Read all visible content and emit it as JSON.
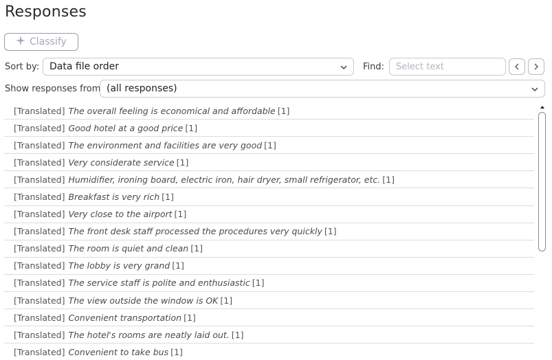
{
  "header": {
    "title": "Responses"
  },
  "toolbar": {
    "classify_label": "Classify"
  },
  "sort": {
    "label": "Sort by:",
    "value": "Data file order"
  },
  "find": {
    "label": "Find:",
    "placeholder": "Select text"
  },
  "filter": {
    "label": "Show responses from:",
    "value": "(all responses)"
  },
  "responses": [
    {
      "tag": "[Translated]",
      "text": "The overall feeling is economical and affordable",
      "count": "[1]"
    },
    {
      "tag": "[Translated]",
      "text": "Good hotel at a good price",
      "count": "[1]"
    },
    {
      "tag": "[Translated]",
      "text": "The environment and facilities are very good",
      "count": "[1]"
    },
    {
      "tag": "[Translated]",
      "text": "Very considerate service",
      "count": "[1]"
    },
    {
      "tag": "[Translated]",
      "text": "Humidifier, ironing board, electric iron, hair dryer, small refrigerator, etc.",
      "count": "[1]"
    },
    {
      "tag": "[Translated]",
      "text": "Breakfast is very rich",
      "count": "[1]"
    },
    {
      "tag": "[Translated]",
      "text": "Very close to the airport",
      "count": "[1]"
    },
    {
      "tag": "[Translated]",
      "text": "The front desk staff processed the procedures very quickly",
      "count": "[1]"
    },
    {
      "tag": "[Translated]",
      "text": "The room is quiet and clean",
      "count": "[1]"
    },
    {
      "tag": "[Translated]",
      "text": "The lobby is very grand",
      "count": "[1]"
    },
    {
      "tag": "[Translated]",
      "text": "The service staff is polite and enthusiastic",
      "count": "[1]"
    },
    {
      "tag": "[Translated]",
      "text": "The view outside the window is OK",
      "count": "[1]"
    },
    {
      "tag": "[Translated]",
      "text": "Convenient transportation",
      "count": "[1]"
    },
    {
      "tag": "[Translated]",
      "text": "The hotel's rooms are neatly laid out.",
      "count": "[1]"
    },
    {
      "tag": "[Translated]",
      "text": "Convenient to take bus",
      "count": "[1]"
    }
  ]
}
